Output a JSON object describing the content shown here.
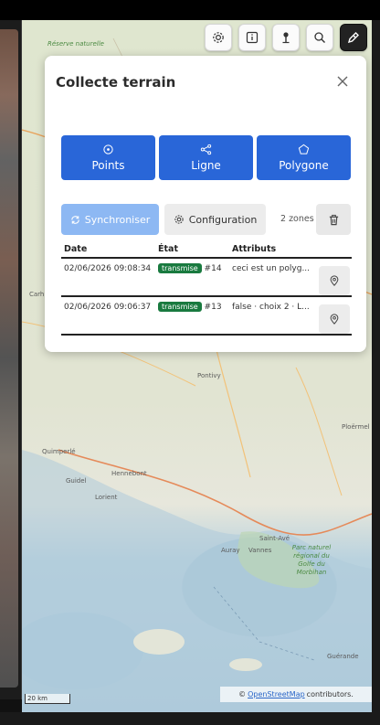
{
  "toolbar": {
    "buttons": [
      {
        "name": "settings",
        "icon": "gear-icon"
      },
      {
        "name": "info",
        "icon": "info-icon"
      },
      {
        "name": "locate",
        "icon": "pin-icon"
      },
      {
        "name": "search",
        "icon": "search-icon"
      },
      {
        "name": "draw",
        "icon": "pencil-icon"
      }
    ]
  },
  "panel": {
    "title": "Collecte terrain",
    "modes": [
      {
        "label": "Points",
        "icon": "target-icon"
      },
      {
        "label": "Ligne",
        "icon": "share-icon"
      },
      {
        "label": "Polygone",
        "icon": "pentagon-icon"
      }
    ],
    "sync_label": "Synchroniser",
    "config_label": "Configuration",
    "zones_count": "2 zones",
    "table": {
      "headers": [
        "Date",
        "État",
        "Attributs"
      ],
      "rows": [
        {
          "date": "02/06/2026 09:08:34",
          "status": "transmise",
          "id": "#14",
          "attributes": "ceci est un polyg..."
        },
        {
          "date": "02/06/2026 09:06:37",
          "status": "transmise",
          "id": "#13",
          "attributes": "false · choix 2 · L..."
        }
      ]
    }
  },
  "map": {
    "labels": {
      "reserve": "Réserve naturelle",
      "pontivy": "Pontivy",
      "quimperle": "Quimperlé",
      "guidel": "Guidel",
      "hennebont": "Hennebont",
      "lorient": "Lorient",
      "auray": "Auray",
      "vannes": "Vannes",
      "saint_ave": "Saint-Avé",
      "ploermel": "Ploërmel",
      "carhaix": "Carh",
      "guerande": "Guérande",
      "parc": "Parc naturel régional du Golfe du Morbihan"
    },
    "scale": "20 km",
    "attribution_prefix": "©",
    "attribution_link": "OpenStreetMap",
    "attribution_suffix": "contributors."
  },
  "colors": {
    "primary": "#2966d8",
    "primary_light": "#8db8f3",
    "badge": "#197a3f"
  }
}
